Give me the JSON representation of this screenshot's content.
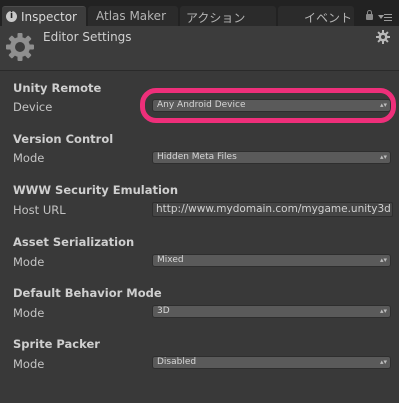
{
  "tabs": [
    {
      "label": "Inspector",
      "active": true
    },
    {
      "label": "Atlas Maker",
      "active": false
    },
    {
      "label": "アクション",
      "active": false
    },
    {
      "label": "イベント",
      "active": false
    }
  ],
  "header": {
    "title": "Editor Settings"
  },
  "sections": {
    "unity_remote": {
      "title": "Unity Remote",
      "row_label": "Device",
      "value": "Any Android Device"
    },
    "version_control": {
      "title": "Version Control",
      "row_label": "Mode",
      "value": "Hidden Meta Files"
    },
    "www_security": {
      "title": "WWW Security Emulation",
      "row_label": "Host URL",
      "value": "http://www.mydomain.com/mygame.unity3d"
    },
    "asset_serialization": {
      "title": "Asset Serialization",
      "row_label": "Mode",
      "value": "Mixed"
    },
    "default_behavior": {
      "title": "Default Behavior Mode",
      "row_label": "Mode",
      "value": "3D"
    },
    "sprite_packer": {
      "title": "Sprite Packer",
      "row_label": "Mode",
      "value": "Disabled"
    }
  },
  "colors": {
    "highlight": "#ee2f7a",
    "background": "#393939",
    "tab_bar": "#222222"
  },
  "icons": {
    "tab_info": "info-icon",
    "lock": "lock-icon",
    "menu": "tab-menu-icon",
    "settings_big": "gear-icon",
    "settings_small": "gear-icon"
  }
}
